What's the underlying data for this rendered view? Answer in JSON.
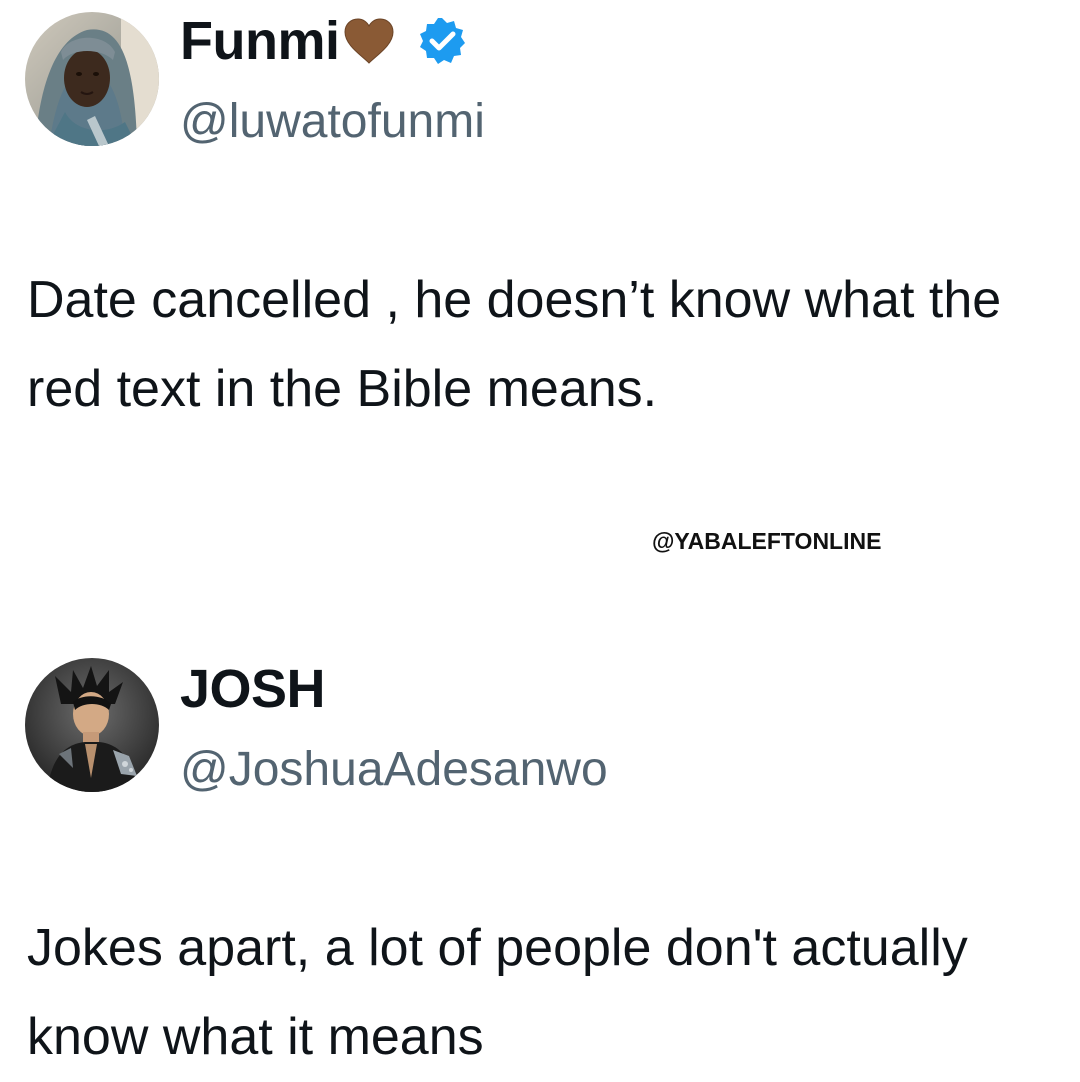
{
  "tweets": [
    {
      "display_name": "Funmi",
      "handle": "@luwatofunmi",
      "text": "Date cancelled , he doesn’t know what the red text in the Bible means.",
      "name_emoji": "brown-heart-icon",
      "verified": true
    },
    {
      "display_name": "JOSH",
      "handle": "@JoshuaAdesanwo",
      "text": "Jokes apart, a lot of people don't actually know what it means",
      "verified": false
    }
  ],
  "watermark": "@YABALEFTONLINE",
  "colors": {
    "text": "#0f1419",
    "handle": "#536471",
    "verified": "#1d9bf0",
    "heart": "#8a5a35"
  }
}
